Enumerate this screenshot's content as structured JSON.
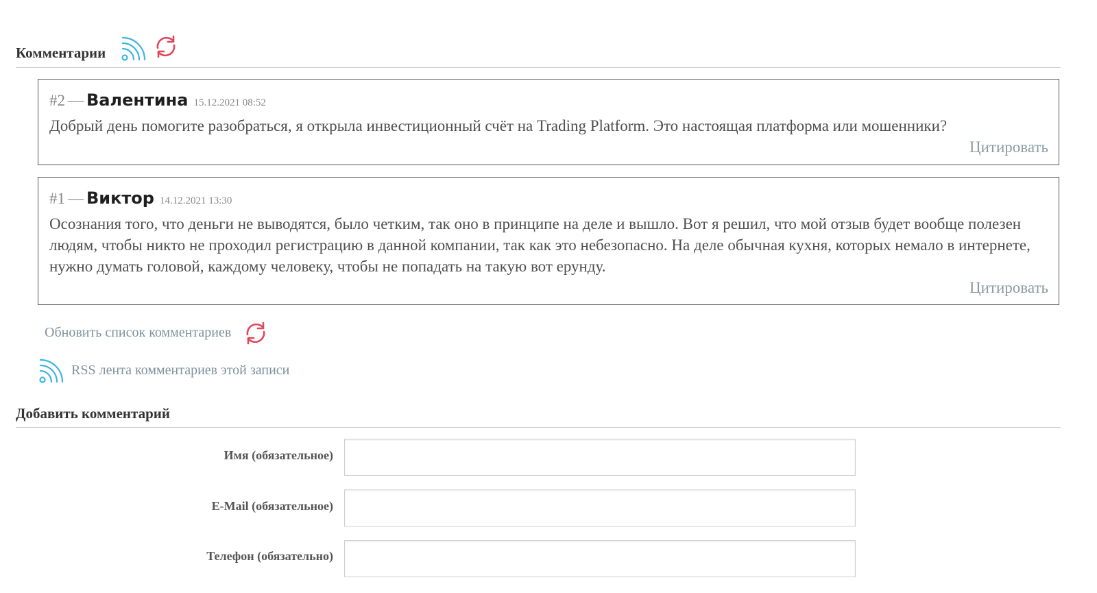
{
  "section": {
    "title": "Комментарии"
  },
  "comments": [
    {
      "number": "#2",
      "dash": "—",
      "author": "Валентина",
      "date": "15.12.2021 08:52",
      "text": "Добрый день помогите разобраться, я открыла инвестиционный счёт на Trading Platform. Это настоящая платформа или мошенники?",
      "quote_label": "Цитировать"
    },
    {
      "number": "#1",
      "dash": "—",
      "author": "Виктор",
      "date": "14.12.2021 13:30",
      "text": "Осознания того, что деньги не выводятся, было четким, так оно в принципе на деле и вышло. Вот я решил, что мой отзыв будет вообще полезен людям, чтобы никто не проходил регистрацию в данной компании, так как это небезопасно. На деле обычная кухня, которых немало в интернете, нужно думать головой, каждому человеку, чтобы не попадать на такую вот ерунду.",
      "quote_label": "Цитировать"
    }
  ],
  "links": {
    "refresh": "Обновить список комментариев",
    "rss": "RSS лента комментариев этой записи"
  },
  "form": {
    "title": "Добавить комментарий",
    "fields": [
      {
        "label": "Имя (обязательное)",
        "value": ""
      },
      {
        "label": "E-Mail (обязательное)",
        "value": ""
      },
      {
        "label": "Телефон (обязательно)",
        "value": ""
      }
    ]
  },
  "icons": {
    "rss": "rss-icon",
    "refresh": "refresh-icon",
    "rss_color": "#3bb4e4",
    "refresh_color": "#e0475b"
  }
}
